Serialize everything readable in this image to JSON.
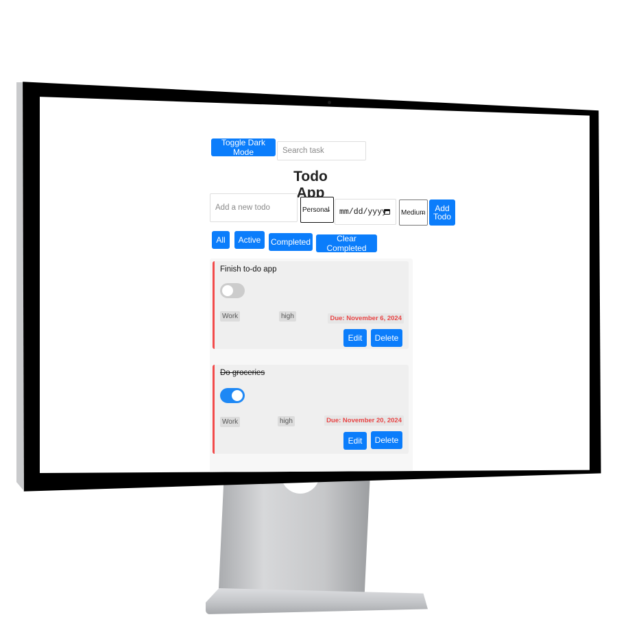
{
  "header": {
    "dark_mode_label": "Toggle Dark Mode",
    "search_placeholder": "Search task",
    "title": "Todo App"
  },
  "add_form": {
    "todo_placeholder": "Add a new todo",
    "category_value": "Personal",
    "date_placeholder": "mm/dd/yyyy",
    "priority_value": "Medium",
    "add_button_label": "Add\nTodo"
  },
  "filters": {
    "all": "All",
    "active": "Active",
    "completed": "Completed",
    "clear_completed": "Clear Completed"
  },
  "todos": [
    {
      "title": "Finish to-do app",
      "completed": false,
      "category": "Work",
      "priority": "high",
      "due": "Due: November 6, 2024",
      "edit_label": "Edit",
      "delete_label": "Delete"
    },
    {
      "title": "Do groceries",
      "completed": true,
      "category": "Work",
      "priority": "high",
      "due": "Due: November 20, 2024",
      "edit_label": "Edit",
      "delete_label": "Delete"
    }
  ],
  "colors": {
    "accent": "#0b7dfb",
    "priority_high_border": "#f24b4b",
    "due_text": "#e84545",
    "toggle_on": "#1e88f5",
    "toggle_off": "#cccccc"
  }
}
